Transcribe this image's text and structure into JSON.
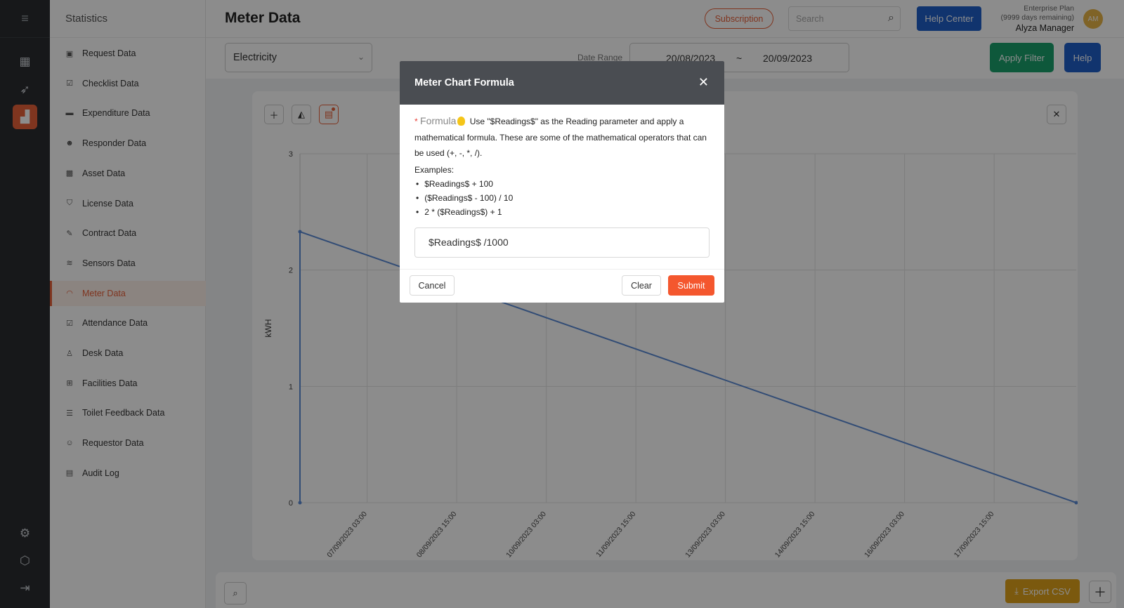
{
  "app": {
    "rail_icons": [
      "menu-collapse-icon",
      "dashboard-icon",
      "rocket-icon",
      "statistics-icon",
      "settings-icon",
      "package-icon",
      "logout-icon"
    ]
  },
  "sidebar": {
    "title": "Statistics",
    "items": [
      {
        "label": "Request Data",
        "icon": "request-icon"
      },
      {
        "label": "Checklist Data",
        "icon": "checklist-icon"
      },
      {
        "label": "Expenditure Data",
        "icon": "wallet-icon"
      },
      {
        "label": "Responder Data",
        "icon": "responder-icon"
      },
      {
        "label": "Asset Data",
        "icon": "asset-icon"
      },
      {
        "label": "License Data",
        "icon": "shield-icon"
      },
      {
        "label": "Contract Data",
        "icon": "contract-icon"
      },
      {
        "label": "Sensors Data",
        "icon": "sensor-icon"
      },
      {
        "label": "Meter Data",
        "icon": "meter-icon",
        "active": true
      },
      {
        "label": "Attendance Data",
        "icon": "attendance-icon"
      },
      {
        "label": "Desk Data",
        "icon": "desk-icon"
      },
      {
        "label": "Facilities Data",
        "icon": "facilities-icon"
      },
      {
        "label": "Toilet Feedback Data",
        "icon": "feedback-icon"
      },
      {
        "label": "Requestor Data",
        "icon": "requestor-icon"
      },
      {
        "label": "Audit Log",
        "icon": "audit-icon"
      }
    ]
  },
  "header": {
    "title": "Meter Data",
    "subscription_label": "Subscription",
    "search_placeholder": "Search",
    "help_center_label": "Help Center",
    "plan_name": "Enterprise Plan",
    "plan_remaining": "(9999 days remaining)",
    "user_name": "Alyza Manager",
    "avatar_initials": "AM"
  },
  "filters": {
    "meter_type": "Electricity",
    "date_range_label": "Date Range",
    "date_from": "20/08/2023",
    "date_separator": "~",
    "date_to": "20/09/2023",
    "apply_label": "Apply Filter",
    "help_label": "Help"
  },
  "chart_data": {
    "type": "line",
    "ylabel": "kWH",
    "xlabel": "",
    "ylim": [
      0,
      3
    ],
    "yticks": [
      "0",
      "1",
      "2",
      "3"
    ],
    "xticks": [
      "07/09/2023 03:00",
      "08/09/2023 15:00",
      "10/09/2023 03:00",
      "11/09/2023 15:00",
      "13/09/2023 03:00",
      "14/09/2023 15:00",
      "16/09/2023 03:00",
      "17/09/2023 15:00"
    ],
    "grid": true,
    "series": [
      {
        "color": "#5b8bd6",
        "points": [
          {
            "x": "06/09/2023 00:00",
            "y": 0
          },
          {
            "x": "06/09/2023 00:00",
            "y": 2.33
          },
          {
            "x": "19/09/2023 00:00",
            "y": 0
          }
        ]
      }
    ]
  },
  "table": {
    "export_label": "Export CSV"
  },
  "modal": {
    "title": "Meter Chart Formula",
    "required_mark": "*",
    "field_label": "Formula",
    "description": "Use \"$Readings$\" as the Reading parameter and apply a mathematical formula. These are some of the mathematical operators that can be used (+, -, *, /).",
    "examples_label": "Examples:",
    "examples": [
      "$Readings$ + 100",
      "($Readings$ - 100) / 10",
      "2 * ($Readings$) + 1"
    ],
    "formula_value": "$Readings$ /1000",
    "cancel_label": "Cancel",
    "clear_label": "Clear",
    "submit_label": "Submit"
  }
}
